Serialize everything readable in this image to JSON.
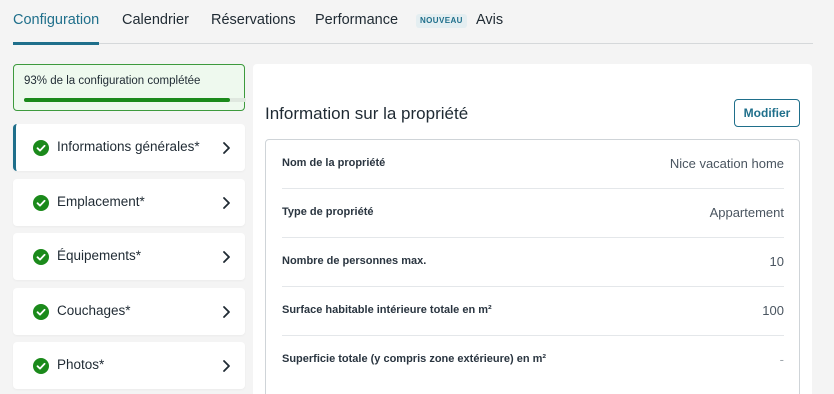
{
  "tabs": [
    {
      "label": "Configuration",
      "active": true
    },
    {
      "label": "Calendrier",
      "active": false
    },
    {
      "label": "Réservations",
      "active": false
    },
    {
      "label": "Performance",
      "active": false,
      "badge": "NOUVEAU"
    },
    {
      "label": "Avis",
      "active": false
    }
  ],
  "progress": {
    "text": "93% de la configuration complétée",
    "percent": 93
  },
  "steps": [
    {
      "label": "Informations générales*",
      "active": true,
      "icon": "check-circle-icon"
    },
    {
      "label": "Emplacement*",
      "active": false,
      "icon": "check-circle-icon"
    },
    {
      "label": "Équipements*",
      "active": false,
      "icon": "check-circle-icon"
    },
    {
      "label": "Couchages*",
      "active": false,
      "icon": "check-circle-icon"
    },
    {
      "label": "Photos*",
      "active": false,
      "icon": "check-circle-icon"
    }
  ],
  "panel": {
    "title": "Information sur la propriété",
    "edit_label": "Modifier",
    "rows": [
      {
        "label": "Nom de la propriété",
        "value": "Nice vacation home"
      },
      {
        "label": "Type de propriété",
        "value": "Appartement"
      },
      {
        "label": "Nombre de personnes max.",
        "value": "10"
      },
      {
        "label": "Surface habitable intérieure totale en m²",
        "value": "100"
      },
      {
        "label": "Superficie totale (y compris zone extérieure) en m²",
        "value": "-"
      }
    ]
  },
  "colors": {
    "accent": "#1f6f8b",
    "success": "#1b8a1b",
    "background": "#f4f4f4"
  }
}
